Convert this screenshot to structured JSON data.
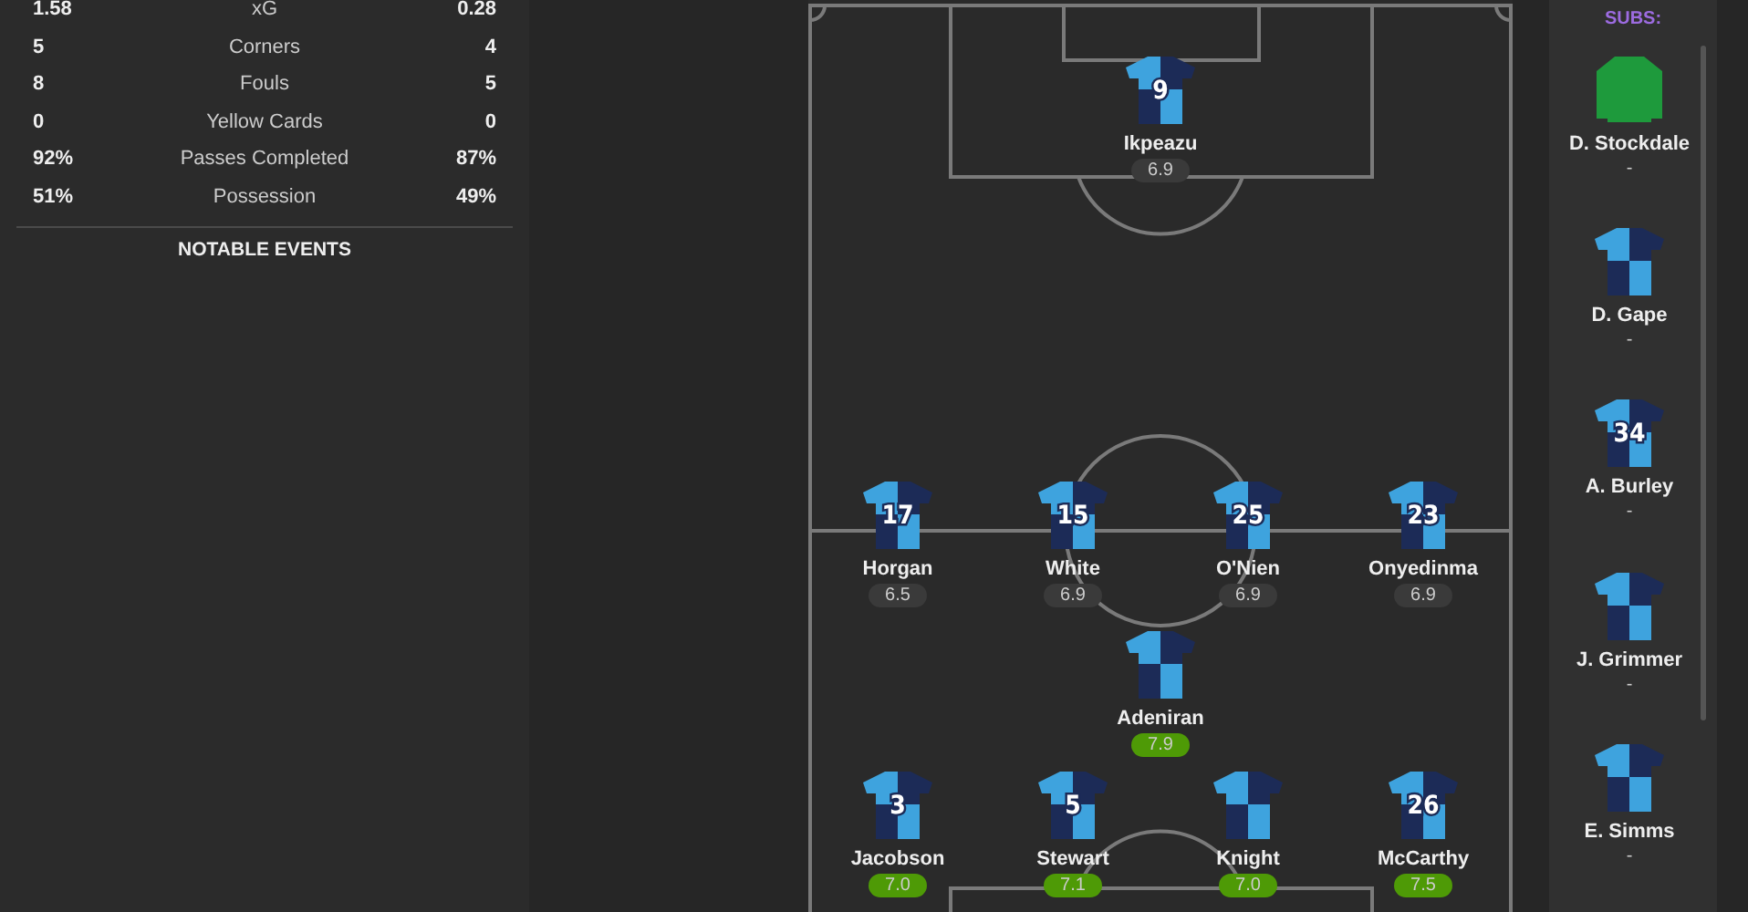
{
  "stats": [
    {
      "home": "1.58",
      "label": "xG",
      "away": "0.28"
    },
    {
      "home": "5",
      "label": "Corners",
      "away": "4"
    },
    {
      "home": "8",
      "label": "Fouls",
      "away": "5"
    },
    {
      "home": "0",
      "label": "Yellow Cards",
      "away": "0"
    },
    {
      "home": "92%",
      "label": "Passes Completed",
      "away": "87%"
    },
    {
      "home": "51%",
      "label": "Possession",
      "away": "49%"
    }
  ],
  "notable_events_heading": "NOTABLE EVENTS",
  "pitch": {
    "lines": [
      [
        {
          "name": "Ikpeazu",
          "number": "9",
          "rating": "6.9",
          "color": "#3a3a3a",
          "kind": "outfield"
        }
      ],
      [
        {
          "name": "Horgan",
          "number": "17",
          "rating": "6.5",
          "color": "#3a3a3a",
          "kind": "outfield"
        },
        {
          "name": "White",
          "number": "15",
          "rating": "6.9",
          "color": "#3a3a3a",
          "kind": "outfield"
        },
        {
          "name": "O'Nien",
          "number": "25",
          "rating": "6.9",
          "color": "#3a3a3a",
          "kind": "outfield"
        },
        {
          "name": "Onyedinma",
          "number": "23",
          "rating": "6.9",
          "color": "#3a3a3a",
          "kind": "outfield"
        }
      ],
      [
        {
          "name": "Adeniran",
          "rating": "7.9",
          "color": "#4e9a06",
          "kind": "outfield"
        }
      ],
      [
        {
          "name": "Jacobson",
          "number": "3",
          "rating": "7.0",
          "color": "#4e9a06",
          "kind": "outfield"
        },
        {
          "name": "Stewart",
          "number": "5",
          "rating": "7.1",
          "color": "#4e9a06",
          "kind": "outfield"
        },
        {
          "name": "Knight",
          "rating": "7.0",
          "color": "#4e9a06",
          "kind": "outfield"
        },
        {
          "name": "McCarthy",
          "number": "26",
          "rating": "7.5",
          "color": "#4e9a06",
          "kind": "outfield"
        }
      ]
    ]
  },
  "subs": {
    "heading": "SUBS:",
    "players": [
      {
        "name": "D. Stockdale",
        "rating": "-",
        "kind": "goalkeeper"
      },
      {
        "name": "D. Gape",
        "rating": "-",
        "kind": "outfield"
      },
      {
        "name": "A. Burley",
        "number": "34",
        "rating": "-",
        "kind": "outfield"
      },
      {
        "name": "J. Grimmer",
        "rating": "-",
        "kind": "outfield"
      },
      {
        "name": "E. Simms",
        "rating": "-",
        "kind": "outfield"
      }
    ]
  }
}
